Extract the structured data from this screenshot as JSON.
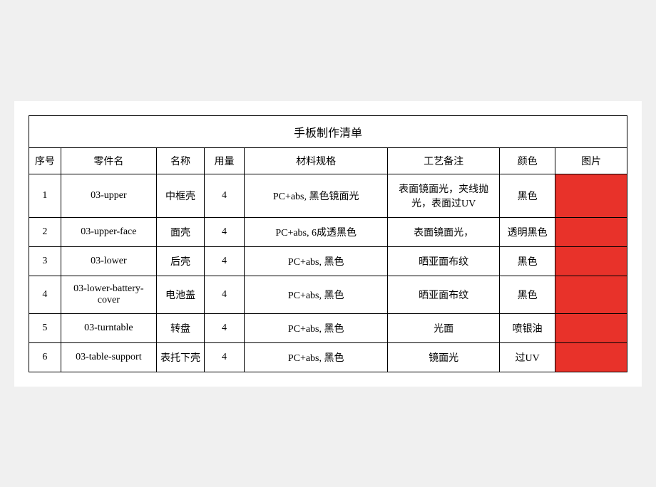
{
  "table": {
    "title": "手板制作清单",
    "headers": {
      "seq": "序号",
      "partname": "零件名",
      "name": "名称",
      "qty": "用量",
      "spec": "材料规格",
      "process": "工艺备注",
      "color": "颜色",
      "image": "图片"
    },
    "rows": [
      {
        "seq": "1",
        "partname": "03-upper",
        "name": "中框壳",
        "qty": "4",
        "spec": "PC+abs, 黑色镜面光",
        "process": "表面镜面光，夹线抛光，表面过UV",
        "color": "黑色"
      },
      {
        "seq": "2",
        "partname": "03-upper-face",
        "name": "面壳",
        "qty": "4",
        "spec": "PC+abs, 6成透黑色",
        "process": "表面镜面光，",
        "color": "透明黑色"
      },
      {
        "seq": "3",
        "partname": "03-lower",
        "name": "后壳",
        "qty": "4",
        "spec": "PC+abs, 黑色",
        "process": "晒亚面布纹",
        "color": "黑色"
      },
      {
        "seq": "4",
        "partname": "03-lower-battery-cover",
        "name": "电池盖",
        "qty": "4",
        "spec": "PC+abs, 黑色",
        "process": "晒亚面布纹",
        "color": "黑色"
      },
      {
        "seq": "5",
        "partname": "03-turntable",
        "name": "转盘",
        "qty": "4",
        "spec": "PC+abs, 黑色",
        "process": "光面",
        "color": "喷银油"
      },
      {
        "seq": "6",
        "partname": "03-table-support",
        "name": "表托下壳",
        "qty": "4",
        "spec": "PC+abs, 黑色",
        "process": "镜面光",
        "color": "过UV"
      }
    ]
  }
}
